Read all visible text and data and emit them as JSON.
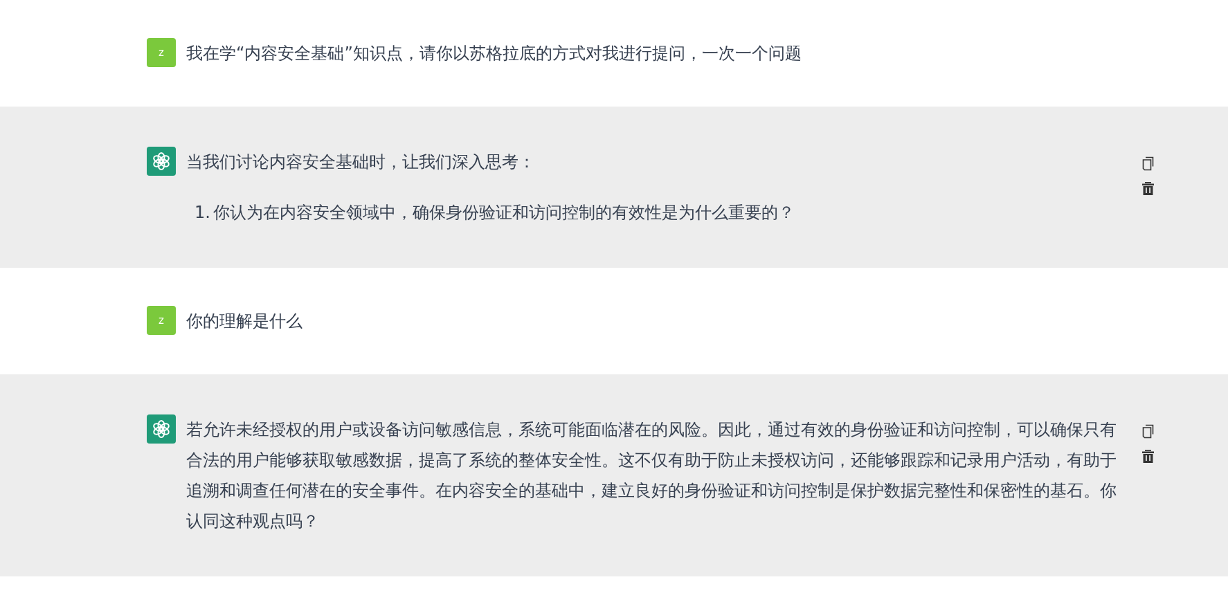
{
  "messages": [
    {
      "kind": "user",
      "avatar": "z",
      "blocks": [
        {
          "kind": "paragraph",
          "text": "我在学“内容安全基础”知识点，请你以苏格拉底的方式对我进行提问，一次一个问题"
        }
      ]
    },
    {
      "kind": "assistant",
      "blocks": [
        {
          "kind": "paragraph",
          "text": "当我们讨论内容安全基础时，让我们深入思考："
        },
        {
          "kind": "list_item",
          "number": "1.",
          "text": "你认为在内容安全领域中，确保身份验证和访问控制的有效性是为什么重要的？"
        }
      ]
    },
    {
      "kind": "user",
      "avatar": "z",
      "blocks": [
        {
          "kind": "paragraph",
          "text": "你的理解是什么"
        }
      ]
    },
    {
      "kind": "assistant",
      "blocks": [
        {
          "kind": "paragraph",
          "text": "若允许未经授权的用户或设备访问敏感信息，系统可能面临潜在的风险。因此，通过有效的身份验证和访问控制，可以确保只有合法的用户能够获取敏感数据，提高了系统的整体安全性。这不仅有助于防止未授权访问，还能够跟踪和记录用户活动，有助于追溯和调查任何潜在的安全事件。在内容安全的基础中，建立良好的身份验证和访问控制是保护数据完整性和保密性的基石。你认同这种观点吗？"
        }
      ]
    }
  ]
}
